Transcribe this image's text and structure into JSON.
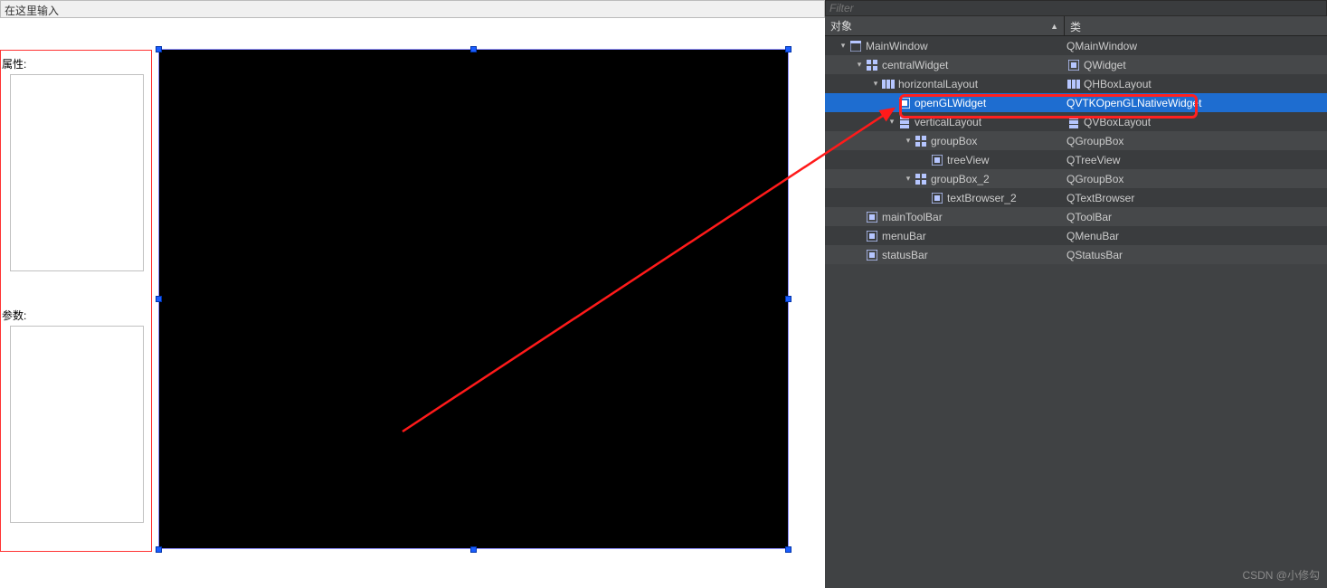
{
  "designer": {
    "filter_placeholder": "在这里输入",
    "labels": {
      "properties": "属性:",
      "params": "参数:"
    }
  },
  "inspector": {
    "filter_placeholder": "Filter",
    "headers": {
      "object": "对象",
      "class": "类"
    },
    "rows": [
      {
        "depth": 0,
        "expander": "▾",
        "icon": "window-icon",
        "name": "MainWindow",
        "class": "QMainWindow",
        "class_icon": "",
        "alt": false,
        "sel": false
      },
      {
        "depth": 1,
        "expander": "▾",
        "icon": "grid-icon",
        "name": "centralWidget",
        "class": "QWidget",
        "class_icon": "widget-icon",
        "alt": true,
        "sel": false
      },
      {
        "depth": 2,
        "expander": "▾",
        "icon": "hlayout-icon",
        "name": "horizontalLayout",
        "class": "QHBoxLayout",
        "class_icon": "hlayout-icon",
        "alt": false,
        "sel": false
      },
      {
        "depth": 3,
        "expander": "",
        "icon": "widget-icon",
        "name": "openGLWidget",
        "class": "QVTKOpenGLNativeWidget",
        "class_icon": "",
        "alt": false,
        "sel": true
      },
      {
        "depth": 3,
        "expander": "▾",
        "icon": "vlayout-icon",
        "name": "verticalLayout",
        "class": "QVBoxLayout",
        "class_icon": "vlayout-icon",
        "alt": false,
        "sel": false
      },
      {
        "depth": 4,
        "expander": "▾",
        "icon": "grid-icon",
        "name": "groupBox",
        "class": "QGroupBox",
        "class_icon": "",
        "alt": true,
        "sel": false
      },
      {
        "depth": 5,
        "expander": "",
        "icon": "widget-icon",
        "name": "treeView",
        "class": "QTreeView",
        "class_icon": "",
        "alt": false,
        "sel": false
      },
      {
        "depth": 4,
        "expander": "▾",
        "icon": "grid-icon",
        "name": "groupBox_2",
        "class": "QGroupBox",
        "class_icon": "",
        "alt": true,
        "sel": false
      },
      {
        "depth": 5,
        "expander": "",
        "icon": "widget-icon",
        "name": "textBrowser_2",
        "class": "QTextBrowser",
        "class_icon": "",
        "alt": false,
        "sel": false
      },
      {
        "depth": 1,
        "expander": "",
        "icon": "widget-icon",
        "name": "mainToolBar",
        "class": "QToolBar",
        "class_icon": "",
        "alt": true,
        "sel": false
      },
      {
        "depth": 1,
        "expander": "",
        "icon": "widget-icon",
        "name": "menuBar",
        "class": "QMenuBar",
        "class_icon": "",
        "alt": false,
        "sel": false
      },
      {
        "depth": 1,
        "expander": "",
        "icon": "widget-icon",
        "name": "statusBar",
        "class": "QStatusBar",
        "class_icon": "",
        "alt": true,
        "sel": false
      }
    ]
  },
  "watermark": "CSDN @小修勾"
}
